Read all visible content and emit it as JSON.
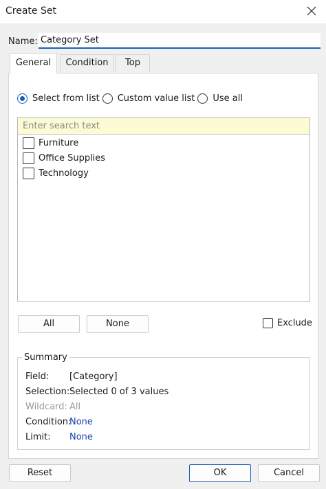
{
  "window": {
    "title": "Create Set"
  },
  "name": {
    "label": "Name:",
    "value": "Category Set"
  },
  "tabs": [
    {
      "label": "General",
      "active": true
    },
    {
      "label": "Condition",
      "active": false
    },
    {
      "label": "Top",
      "active": false
    }
  ],
  "mode": {
    "options": [
      "Select from list",
      "Custom value list",
      "Use all"
    ],
    "selected": "Select from list"
  },
  "search": {
    "placeholder": "Enter search text"
  },
  "list": {
    "items": [
      {
        "label": "Furniture",
        "checked": false
      },
      {
        "label": "Office Supplies",
        "checked": false
      },
      {
        "label": "Technology",
        "checked": false
      }
    ]
  },
  "buttons": {
    "all": "All",
    "none": "None",
    "reset": "Reset",
    "ok": "OK",
    "cancel": "Cancel"
  },
  "exclude": {
    "label": "Exclude",
    "checked": false
  },
  "summary": {
    "title": "Summary",
    "field_label": "Field:",
    "field_value": "[Category]",
    "selection_label": "Selection:",
    "selection_value": "Selected 0 of 3 values",
    "wildcard_label": "Wildcard:",
    "wildcard_value": "All",
    "condition_label": "Condition:",
    "condition_value": "None",
    "limit_label": "Limit:",
    "limit_value": "None"
  },
  "colors": {
    "accent": "#1a5fb4",
    "search_bg": "#fdfbd3",
    "link": "#1a3fb4"
  },
  "icons": {
    "close": "close-icon"
  }
}
